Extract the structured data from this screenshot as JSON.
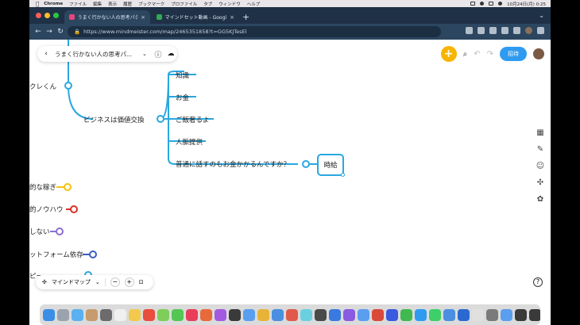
{
  "menubar": {
    "app_name": "Chrome",
    "items": [
      "ファイル",
      "編集",
      "表示",
      "履歴",
      "ブックマーク",
      "プロファイル",
      "タブ",
      "ウィンドウ",
      "ヘルプ"
    ],
    "datetime": "10月24日(月)  0:25"
  },
  "tabs": [
    {
      "label": "うまく行かない人の思考パターン",
      "color": "#e8457a"
    },
    {
      "label": "マインドセット動画 - Google ド",
      "color": "#34a853"
    }
  ],
  "address_bar": {
    "url": "https://www.mindmeister.com/map/2465351858?t=GG5KJTesEl"
  },
  "map_header": {
    "title": "うまく行かない人の思考パ..."
  },
  "toolbar": {
    "invite_label": "招待"
  },
  "mindmap": {
    "left_edge_nodes": [
      "クレくん",
      "的な稼ぎ",
      "的ノウハウ",
      "しない",
      "ットフォーム依存",
      "ピーー"
    ],
    "branch": "ビジネスは価値交換",
    "children": [
      "知識",
      "お金",
      "ご飯奢るよ",
      "人脈提供",
      "普通に話すのもお金かかるんですか？"
    ],
    "selected_node": "時給",
    "colors": {
      "branch": "#2aa7e0",
      "yellow": "#f4c20d",
      "red": "#d93025",
      "purple": "#8a6fd1",
      "blue": "#3c5cc4"
    }
  },
  "bottom_controls": {
    "view_label": "マインドマップ",
    "zoom_out": "−",
    "zoom_in": "+"
  },
  "icons": [
    "back-icon",
    "info-icon",
    "cloud-icon",
    "add-icon",
    "search-icon",
    "undo-icon",
    "redo-icon",
    "help-icon"
  ]
}
